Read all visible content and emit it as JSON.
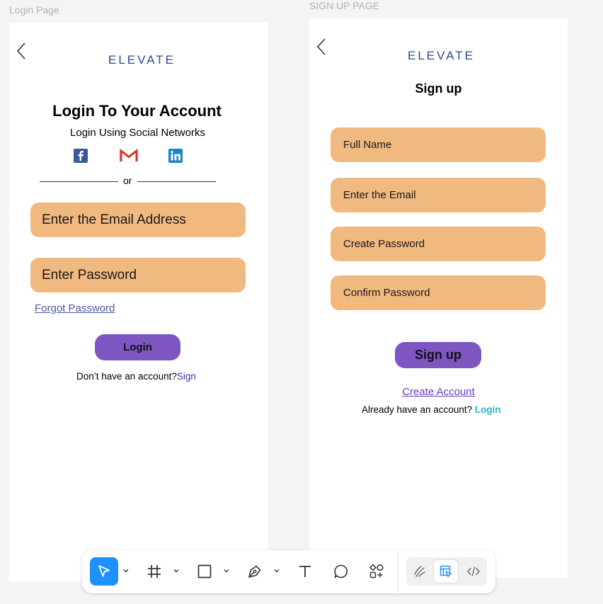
{
  "login": {
    "frame_label": "Login Page",
    "logo": "ELEVATE",
    "title": "Login To Your Account",
    "subtitle": "Login Using Social Networks",
    "divider": "or",
    "email_placeholder": "Enter the Email Address",
    "password_placeholder": "Enter Password",
    "forgot": "Forgot Password",
    "button": "Login",
    "no_account": "Don’t have an account?",
    "sign_link": "Sign",
    "socials": [
      "facebook-icon",
      "gmail-icon",
      "linkedin-icon"
    ]
  },
  "signup": {
    "frame_label": "SIGN UP PAGE",
    "logo": "ELEVATE",
    "title": "Sign up",
    "fields": [
      "Full Name",
      "Enter the Email",
      "Create Password",
      "Confirm Password"
    ],
    "button": "Sign up",
    "create_account": "Create Account",
    "have_account": "Already have an account?",
    "login_link": "Login"
  },
  "toolbar": {
    "tools": [
      "move-icon",
      "frame-icon",
      "rectangle-icon",
      "pen-icon",
      "text-icon",
      "comment-icon",
      "components-icon"
    ],
    "modes": [
      "draw-mode-icon",
      "design-mode-icon",
      "dev-mode-icon"
    ]
  },
  "colors": {
    "field": "#f0b980",
    "button": "#7d56c2",
    "logo": "#2e4a8a",
    "link_teal": "#2bb3c7",
    "link_purple": "#4a2a9a",
    "active_tool": "#1e90ff"
  }
}
